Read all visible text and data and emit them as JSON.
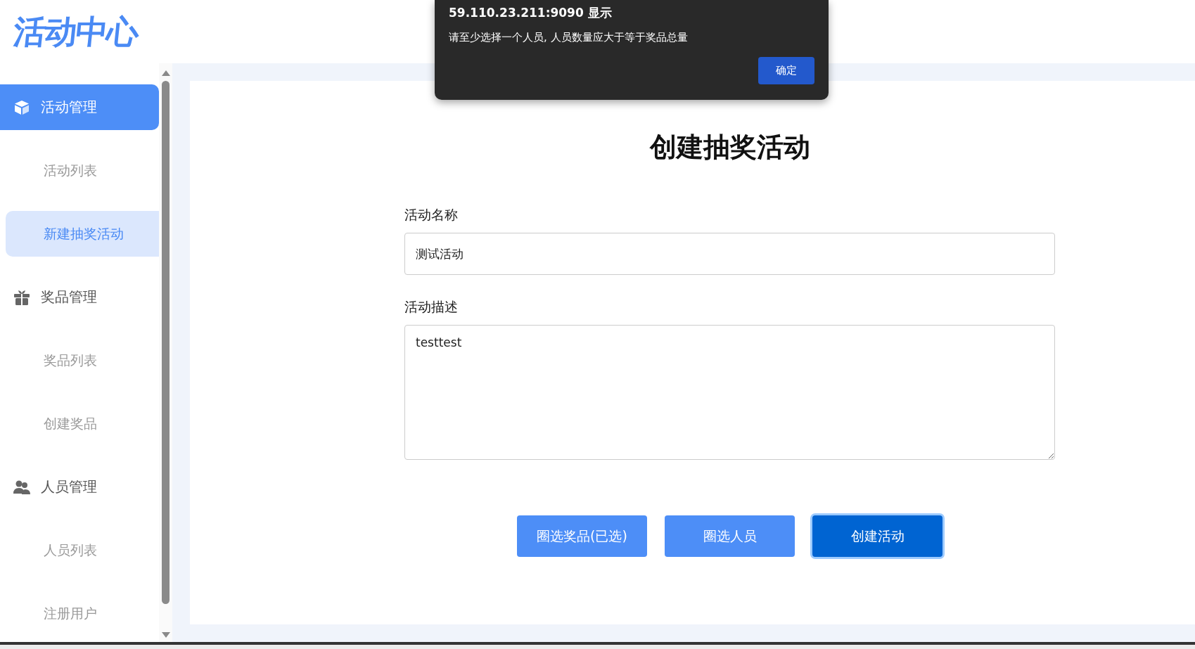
{
  "header": {
    "logo": "活动中心"
  },
  "sidebar": {
    "groups": [
      {
        "label": "活动管理",
        "selected": true,
        "items": [
          {
            "label": "活动列表",
            "selected": false
          },
          {
            "label": "新建抽奖活动",
            "selected": true
          }
        ]
      },
      {
        "label": "奖品管理",
        "selected": false,
        "items": [
          {
            "label": "奖品列表",
            "selected": false
          },
          {
            "label": "创建奖品",
            "selected": false
          }
        ]
      },
      {
        "label": "人员管理",
        "selected": false,
        "items": [
          {
            "label": "人员列表",
            "selected": false
          },
          {
            "label": "注册用户",
            "selected": false
          }
        ]
      }
    ]
  },
  "form": {
    "title": "创建抽奖活动",
    "fields": [
      {
        "kind": "input",
        "label": "活动名称",
        "value": "测试活动"
      },
      {
        "kind": "textarea",
        "label": "活动描述",
        "value": "testtest"
      }
    ],
    "buttons": [
      {
        "label": "圈选奖品(已选)",
        "focused": false
      },
      {
        "label": "圈选人员",
        "focused": false
      },
      {
        "label": "创建活动",
        "focused": true
      }
    ]
  },
  "dialog": {
    "title": "59.110.23.211:9090 显示",
    "message": "请至少选择一个人员, 人员数量应大于等于奖品总量",
    "button": "确定"
  }
}
